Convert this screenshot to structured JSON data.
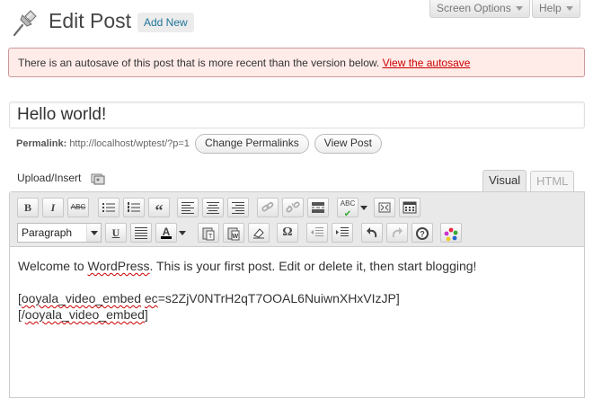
{
  "screen_meta": {
    "screen_options_label": "Screen Options",
    "help_label": "Help"
  },
  "header": {
    "title": "Edit Post",
    "add_new_label": "Add New"
  },
  "notice": {
    "text": "There is an autosave of this post that is more recent than the version below.",
    "link_label": "View the autosave"
  },
  "post": {
    "title": "Hello world!",
    "permalink_label": "Permalink:",
    "permalink_url": "http://localhost/wptest/?p=1",
    "change_permalinks_label": "Change Permalinks",
    "view_post_label": "View Post"
  },
  "editor": {
    "upload_insert_label": "Upload/Insert",
    "tabs": [
      {
        "label": "Visual",
        "active": true
      },
      {
        "label": "HTML",
        "active": false
      }
    ],
    "format_select_value": "Paragraph",
    "content": {
      "line1_a": "Welcome to ",
      "line1_misspelled": "WordPress",
      "line1_b": ". This is your first post. Edit or delete it, then start blogging!",
      "line3_a": "[",
      "line3_misspelled": "ooyala_video_embed",
      "line3_b": " ",
      "line3_misspelled2": "ec",
      "line3_c": "=s2ZjV0NTrH2qT7OOAL6NuiwnXHxVIzJP]",
      "line4_a": "[/",
      "line4_misspelled": "ooyala_video_embed",
      "line4_b": "]"
    },
    "toolbar_row1_icons": [
      "bold-icon",
      "italic-icon",
      "strikethrough-icon",
      "bullet-list-icon",
      "numbered-list-icon",
      "blockquote-icon",
      "align-left-icon",
      "align-center-icon",
      "align-right-icon",
      "link-icon",
      "unlink-icon",
      "more-tag-icon",
      "spellcheck-icon",
      "fullscreen-icon",
      "kitchen-sink-icon"
    ],
    "toolbar_row2_icons": [
      "underline-icon",
      "justify-icon",
      "text-color-icon",
      "paste-text-icon",
      "paste-word-icon",
      "clear-formatting-icon",
      "special-character-icon",
      "outdent-icon",
      "indent-icon",
      "undo-icon",
      "redo-icon",
      "help-icon",
      "color-palette-icon"
    ]
  },
  "colors": {
    "notice_bg": "#ffebe8",
    "notice_border": "#cc9999",
    "link": "#21759b",
    "notice_link": "#cc0000"
  }
}
